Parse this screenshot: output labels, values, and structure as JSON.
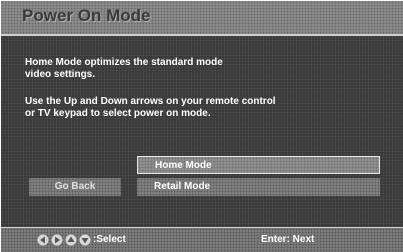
{
  "header": {
    "title": "Power On Mode"
  },
  "description": {
    "line1": "Home Mode optimizes the standard mode\nvideo settings.",
    "line2": "Use the Up and Down arrows on your remote control\nor TV keypad to select power on mode."
  },
  "options": [
    {
      "label": "Home Mode",
      "selected": true
    },
    {
      "label": "Retail Mode",
      "selected": false
    }
  ],
  "go_back_label": "Go Back",
  "footer": {
    "icons": [
      "left-arrow-icon",
      "right-arrow-icon",
      "up-arrow-icon",
      "down-arrow-icon"
    ],
    "select_hint": ":Select",
    "enter_hint": "Enter: Next"
  }
}
